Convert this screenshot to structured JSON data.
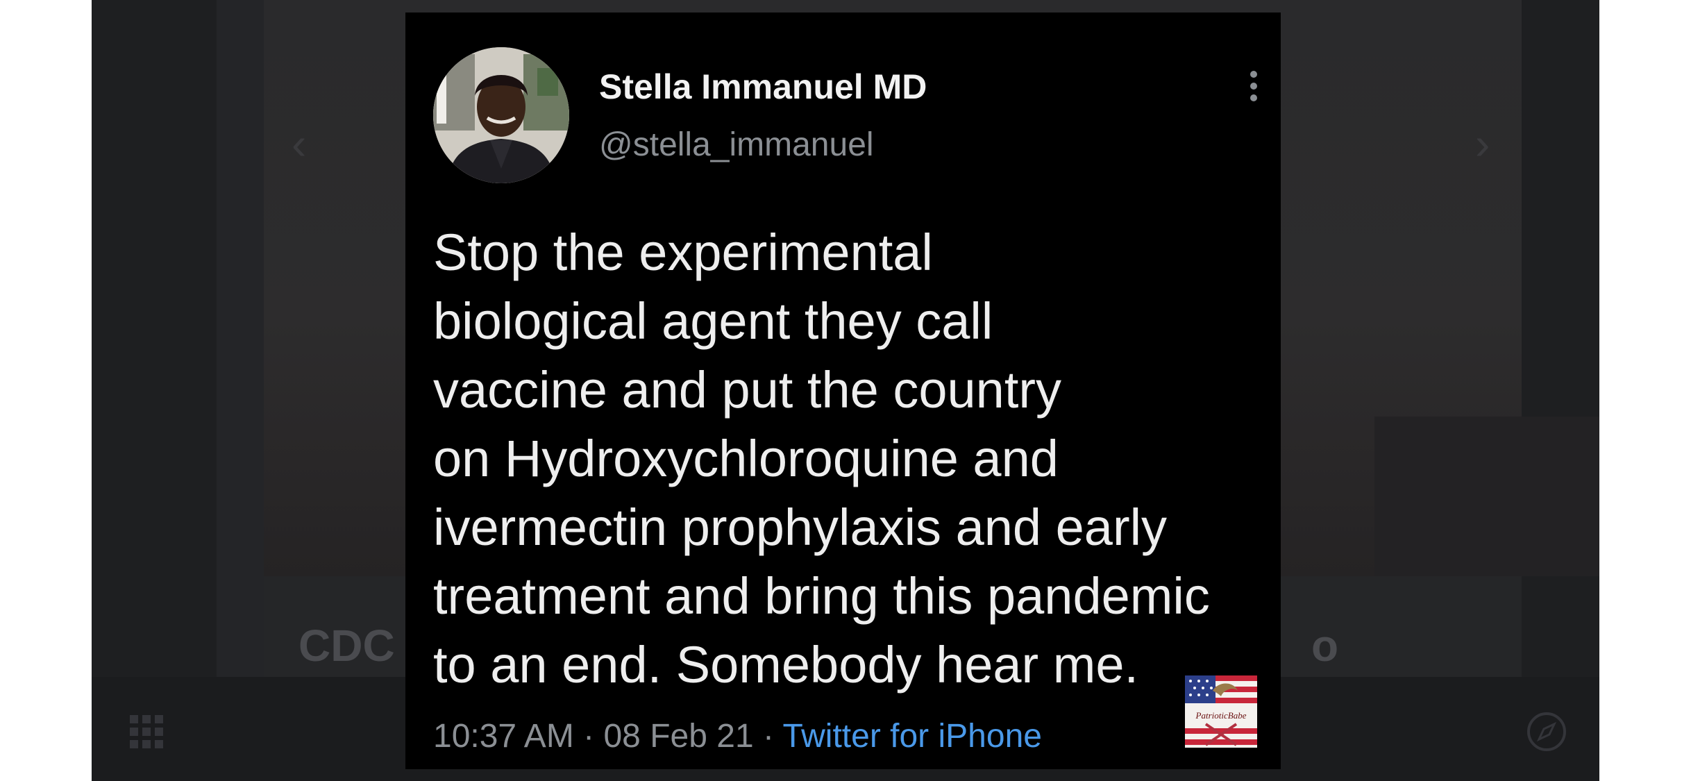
{
  "background_app": {
    "headline_left_fragment": "CDC",
    "headline_right_fragment": "o",
    "prev_icon": "chevron-left-icon",
    "next_icon": "chevron-right-icon",
    "apps_icon": "grid-icon",
    "browser_icon": "compass-icon"
  },
  "tweet": {
    "display_name": "Stella Immanuel MD",
    "handle": "@stella_immanuel",
    "text": "Stop the experimental\nbiological agent they call\nvaccine and put the country\non Hydroxychloroquine and\nivermectin prophylaxis and early\ntreatment and bring this pandemic\nto an end. Somebody hear me.",
    "time": "10:37 AM",
    "separator": "·",
    "date": "08 Feb 21",
    "source": "Twitter for iPhone",
    "menu_icon": "more-vertical-icon",
    "avatar_icon": "avatar"
  },
  "watermark": {
    "text": "PatrioticBabe"
  },
  "colors": {
    "card_background": "#000000",
    "text": "#e7e9ea",
    "secondary_text": "#8b8f94",
    "link": "#4a99e9",
    "dimmed_background": "#1e1f21"
  }
}
